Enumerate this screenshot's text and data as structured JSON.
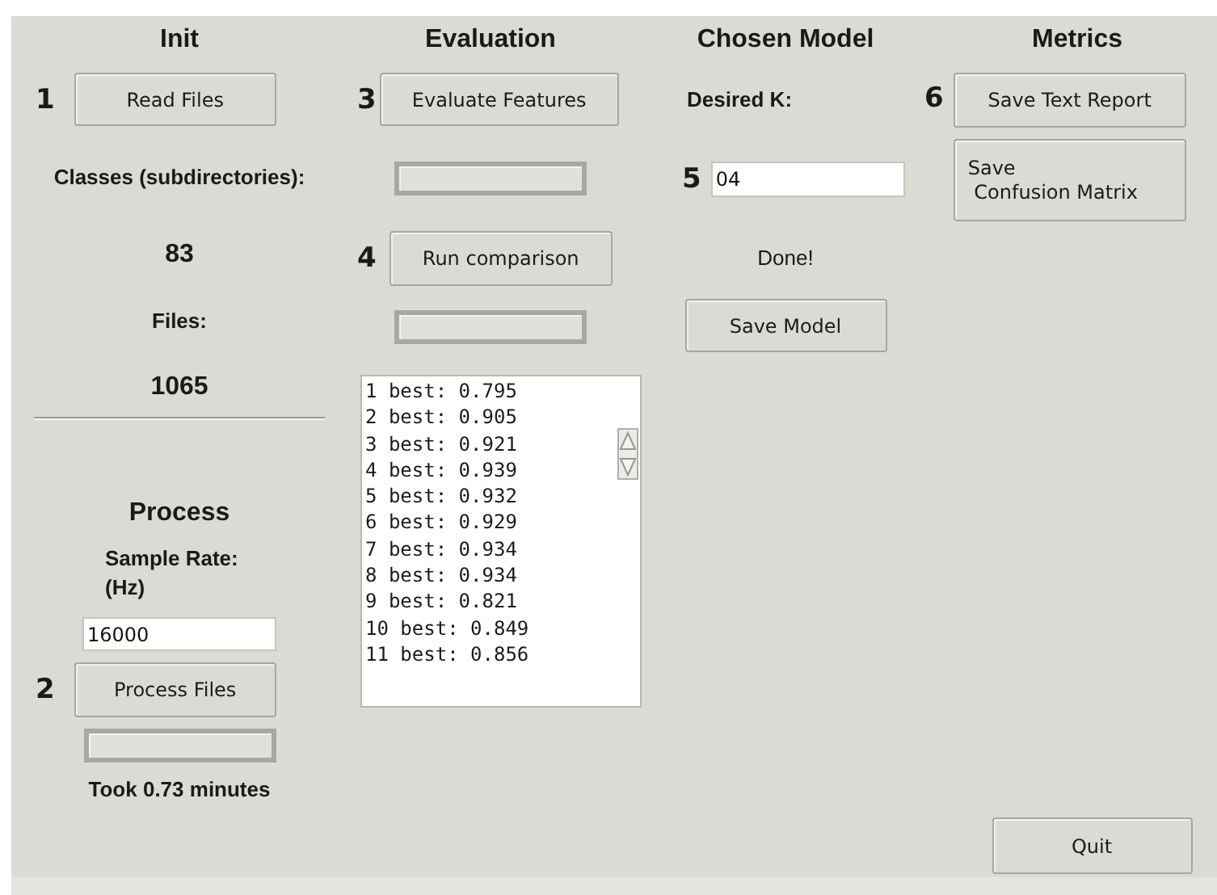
{
  "init": {
    "title": "Init",
    "step": "1",
    "read_button": "Read Files",
    "classes_label": "Classes (subdirectories):",
    "classes_count": "83",
    "files_label": "Files:",
    "files_count": "1065"
  },
  "process": {
    "title": "Process",
    "rate_label": "Sample Rate:\n(Hz)",
    "rate_value": "16000",
    "step": "2",
    "button": "Process Files",
    "progress": {
      "level": 0
    },
    "status": "Took 0.73 minutes"
  },
  "evaluation": {
    "title": "Evaluation",
    "evaluate_step": "3",
    "evaluate_button": "Evaluate Features",
    "evaluate_progress": {
      "level": 0
    },
    "compare_step": "4",
    "compare_button": "Run comparison",
    "compare_progress": {
      "level": 0
    },
    "results": [
      "1 best: 0.795",
      "2 best: 0.905",
      "3 best: 0.921",
      "4 best: 0.939",
      "5 best: 0.932",
      "6 best: 0.929",
      "7 best: 0.934",
      "8 best: 0.934",
      "9 best: 0.821",
      "10 best: 0.849",
      "11 best: 0.856"
    ]
  },
  "chosen_model": {
    "title": "Chosen Model",
    "k_label": "Desired K:",
    "step": "5",
    "k_value": "04",
    "status": "Done!",
    "save_button": "Save Model"
  },
  "metrics": {
    "title": "Metrics",
    "step": "6",
    "buttons": [
      "Save Text Report",
      "Save\n Confusion Matrix"
    ]
  },
  "quit_button": "Quit"
}
